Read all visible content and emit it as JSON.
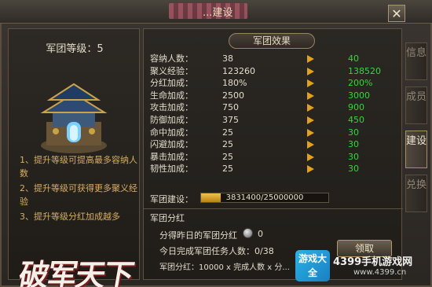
{
  "window": {
    "title": "...建设",
    "close_label": "✕"
  },
  "left": {
    "level_label": "军团等级：5",
    "tips": [
      "1、提升等级可提高最多容纳人数",
      "2、提升等级可获得更多聚义经验",
      "3、提升等级分红加成越多"
    ],
    "logo_text": "破军天下"
  },
  "right": {
    "effects_title": "军团效果",
    "stats": [
      {
        "label": "容纳人数：",
        "current": "38",
        "next": "40"
      },
      {
        "label": "聚义经验：",
        "current": "123260",
        "next": "138520"
      },
      {
        "label": "分红加成：",
        "current": "180%",
        "next": "200%"
      },
      {
        "label": "生命加成：",
        "current": "2500",
        "next": "3000"
      },
      {
        "label": "攻击加成：",
        "current": "750",
        "next": "900"
      },
      {
        "label": "防御加成：",
        "current": "375",
        "next": "450"
      },
      {
        "label": "命中加成：",
        "current": "25",
        "next": "30"
      },
      {
        "label": "闪避加成：",
        "current": "25",
        "next": "30"
      },
      {
        "label": "暴击加成：",
        "current": "25",
        "next": "30"
      },
      {
        "label": "韧性加成：",
        "current": "25",
        "next": "30"
      }
    ],
    "build": {
      "label": "军团建设：",
      "progress_text": "3831400/25000000",
      "progress_fraction": 0.153
    },
    "bonus": {
      "title": "军团分红",
      "yesterday_label": "分得昨日的军团分红",
      "yesterday_value": "0",
      "today_label": "今日完成军团任务人数：0/38",
      "formula": "军团分红：10000 x 完成人数 x 分...",
      "claim_label": "领取"
    }
  },
  "tabs": [
    {
      "label": "信息",
      "active": false
    },
    {
      "label": "成员",
      "active": false
    },
    {
      "label": "建设",
      "active": true
    },
    {
      "label": "兑换",
      "active": false
    }
  ],
  "watermark": {
    "logo": "游戏大全",
    "brand": "4399手机游戏网",
    "url": "www.4399.cn"
  },
  "colors": {
    "next_value": "#35d63a",
    "tip_text": "#d8ae62",
    "arrow": "#e2a21c"
  }
}
